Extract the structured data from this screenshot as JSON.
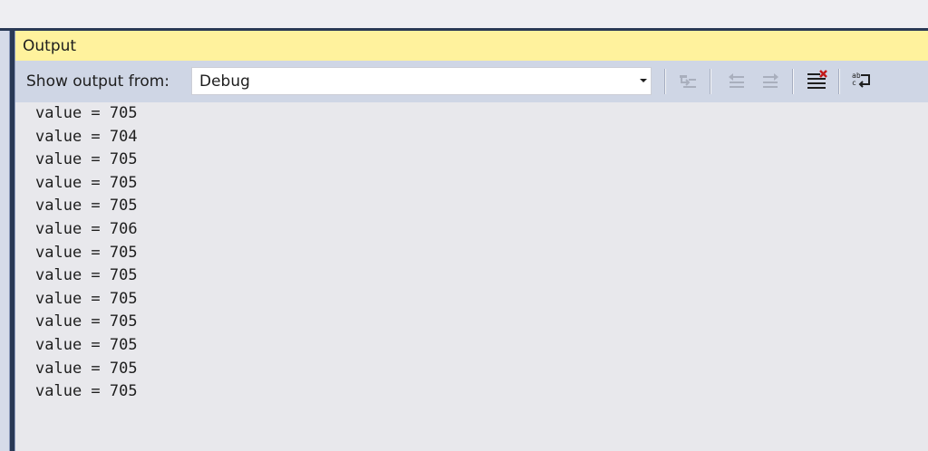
{
  "output_panel": {
    "title": "Output",
    "toolbar": {
      "show_output_from_label": "Show output from:",
      "selected_source": "Debug",
      "buttons": [
        {
          "name": "go-to-code-icon",
          "enabled": false
        },
        {
          "name": "previous-message-icon",
          "enabled": false
        },
        {
          "name": "next-message-icon",
          "enabled": false
        },
        {
          "name": "clear-all-icon",
          "enabled": true
        },
        {
          "name": "word-wrap-icon",
          "enabled": true
        }
      ]
    },
    "lines": [
      "value = 705",
      "value = 704",
      "value = 705",
      "value = 705",
      "value = 705",
      "value = 706",
      "value = 705",
      "value = 705",
      "value = 705",
      "value = 705",
      "value = 705",
      "value = 705",
      "value = 705"
    ]
  },
  "colors": {
    "title_bar": "#fff29d",
    "toolbar": "#cfd6e5",
    "frame": "#293955",
    "output_background": "#e8e8ec",
    "clear_accent": "#c21a1a"
  }
}
